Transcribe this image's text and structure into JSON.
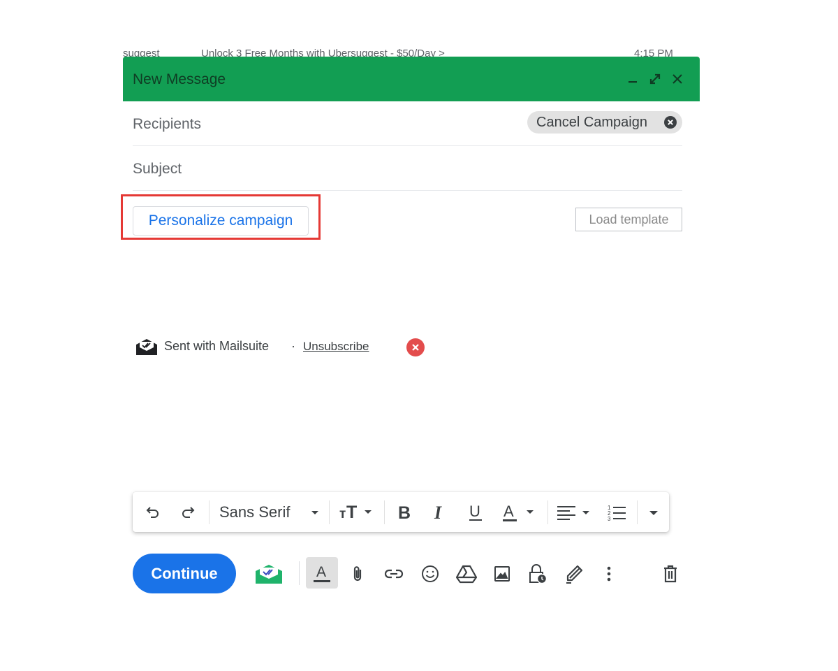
{
  "background_email_row": {
    "sender": "suggest",
    "snippet": "Unlock 3 Free Months with Ubersuggest - $50/Day >",
    "time": "4:15 PM"
  },
  "compose": {
    "title": "New Message",
    "recipients_label": "Recipients",
    "subject_label": "Subject",
    "campaign_chip": "Cancel Campaign",
    "personalize_button": "Personalize campaign",
    "load_template_button": "Load template",
    "signature": {
      "text": "Sent with Mailsuite",
      "separator": "·",
      "link": "Unsubscribe"
    },
    "toolbar": {
      "font_name": "Sans Serif"
    },
    "continue_button": "Continue"
  },
  "colors": {
    "header_bg": "#129e53",
    "primary": "#1a73e8",
    "highlight_box": "#e53935",
    "remove_signature": "#e34c4c"
  },
  "icons": {
    "header": [
      "minimize-icon",
      "expand-icon",
      "close-icon"
    ],
    "format_toolbar": [
      "undo-icon",
      "redo-icon",
      "font-dropdown-icon",
      "text-size-icon",
      "bold-icon",
      "italic-icon",
      "underline-icon",
      "text-color-icon",
      "align-icon",
      "numbered-list-icon",
      "more-formatting-icon"
    ],
    "bottom_toolbar": [
      "mailsuite-icon",
      "formatting-options-icon",
      "attach-icon",
      "link-icon",
      "emoji-icon",
      "drive-icon",
      "photo-icon",
      "confidential-mode-icon",
      "signature-icon",
      "more-options-icon",
      "discard-icon"
    ]
  }
}
